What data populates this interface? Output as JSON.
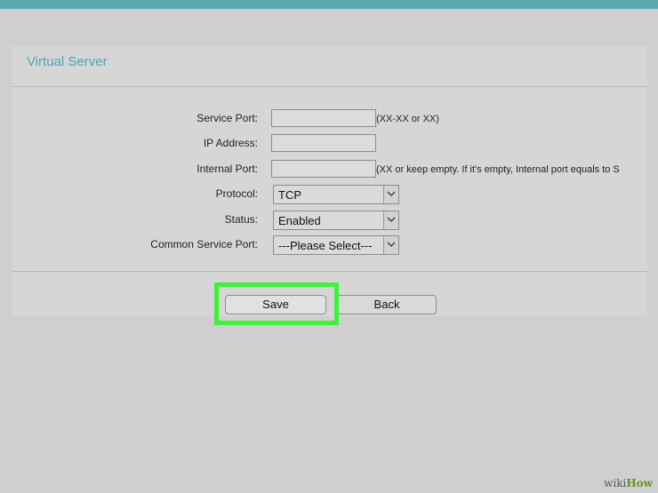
{
  "section": {
    "title": "Virtual Server"
  },
  "form": {
    "service_port": {
      "label": "Service Port:",
      "value": "",
      "hint": "(XX-XX or XX)"
    },
    "ip_address": {
      "label": "IP Address:",
      "value": ""
    },
    "internal_port": {
      "label": "Internal Port:",
      "value": "",
      "hint": "(XX or keep empty. If it's empty, Internal port equals to S"
    },
    "protocol": {
      "label": "Protocol:",
      "selected": "TCP"
    },
    "status": {
      "label": "Status:",
      "selected": "Enabled"
    },
    "common_service_port": {
      "label": "Common Service Port:",
      "selected": "---Please Select---"
    }
  },
  "buttons": {
    "save": "Save",
    "back": "Back"
  },
  "watermark": {
    "prefix": "wiki",
    "brand": "How"
  },
  "colors": {
    "accent": "#4aa5b4",
    "highlight": "#3ef23a",
    "top_bar": "#5aa9ad"
  }
}
